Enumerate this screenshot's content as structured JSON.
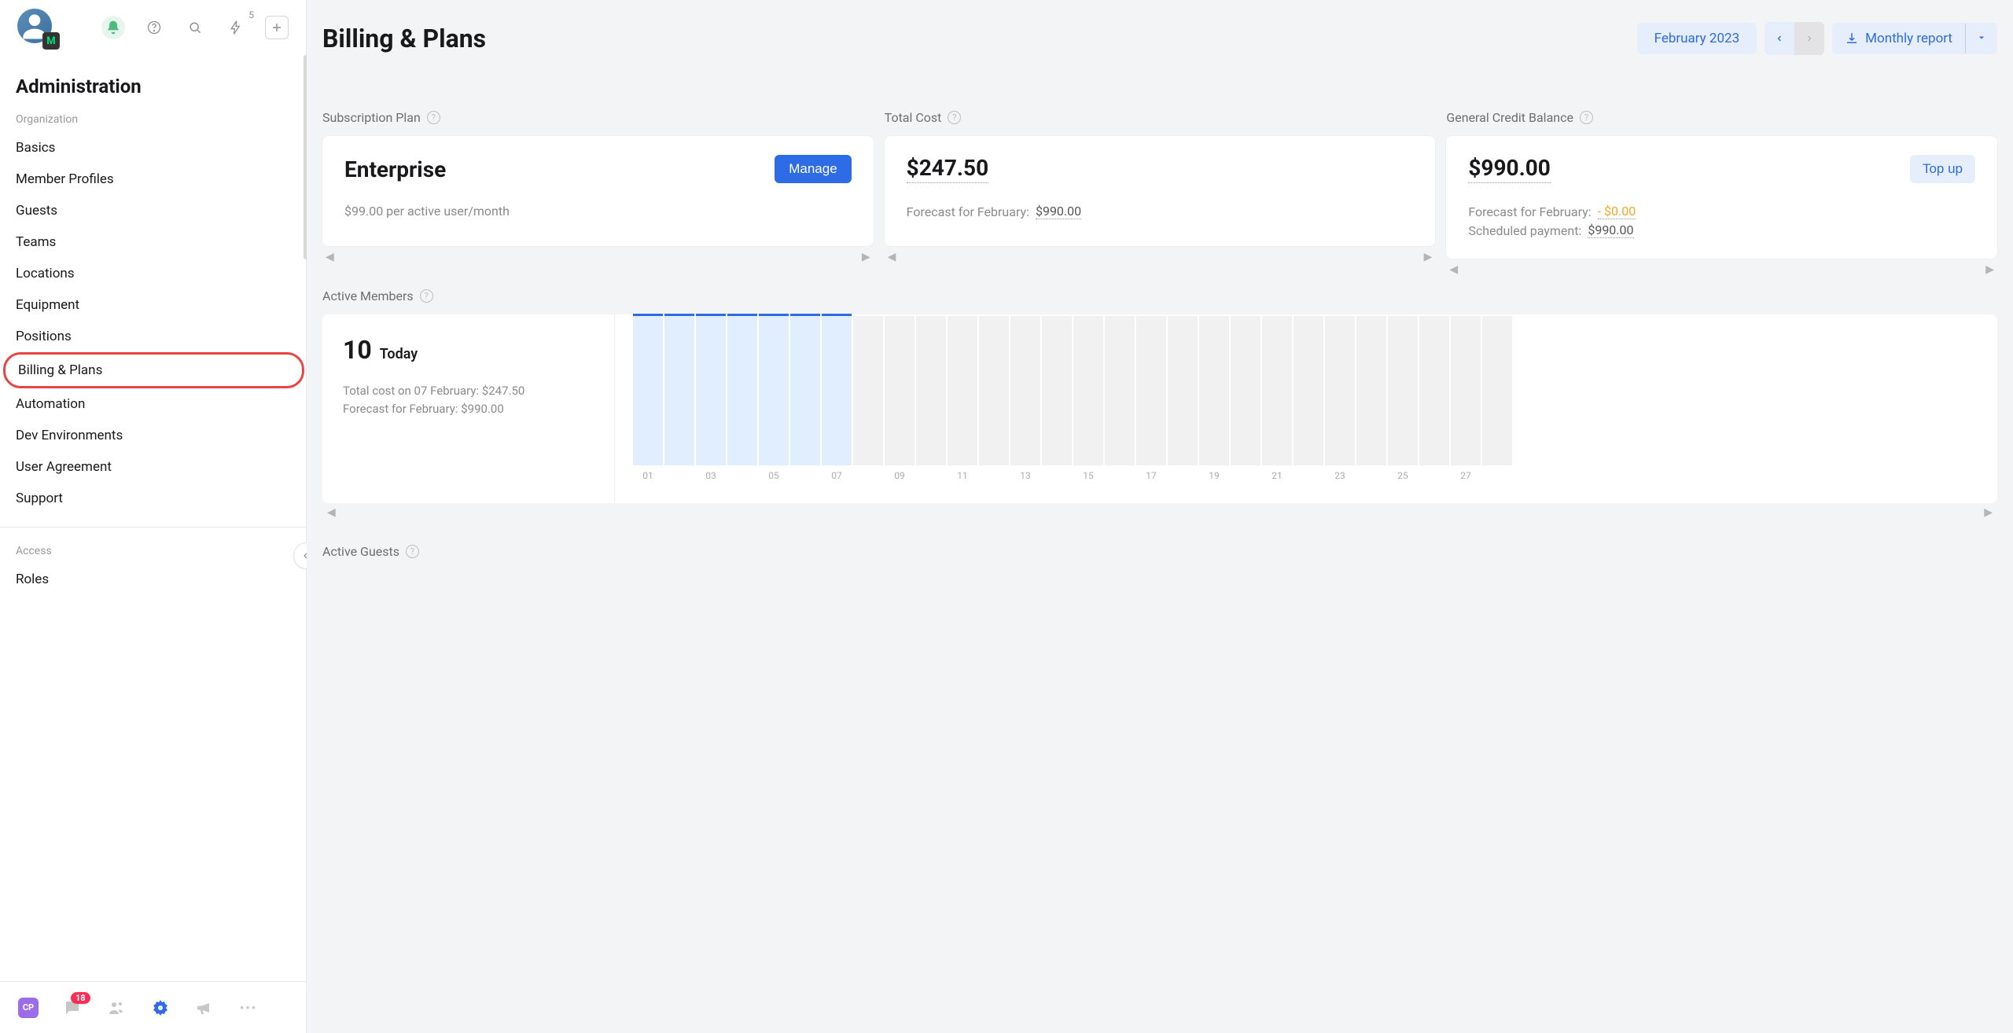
{
  "topbar": {
    "bolt_badge": "5"
  },
  "sidebar": {
    "section_title": "Administration",
    "group_org": "Organization",
    "group_access": "Access",
    "items_org": [
      "Basics",
      "Member Profiles",
      "Guests",
      "Teams",
      "Locations",
      "Equipment",
      "Positions",
      "Billing & Plans",
      "Automation",
      "Dev Environments",
      "User Agreement",
      "Support"
    ],
    "items_access": [
      "Roles"
    ],
    "active_item": "Billing & Plans"
  },
  "bottom": {
    "cp": "CP",
    "chat_badge": "18"
  },
  "header": {
    "title": "Billing & Plans",
    "period": "February 2023",
    "report_label": "Monthly report"
  },
  "cards": {
    "plan": {
      "section": "Subscription Plan",
      "name": "Enterprise",
      "manage": "Manage",
      "sub": "$99.00 per active user/month"
    },
    "cost": {
      "section": "Total Cost",
      "amount": "$247.50",
      "forecast_label": "Forecast for February:",
      "forecast_value": "$990.00"
    },
    "credit": {
      "section": "General Credit Balance",
      "amount": "$990.00",
      "topup": "Top up",
      "forecast_label": "Forecast for February:",
      "forecast_value": "- $0.00",
      "scheduled_label": "Scheduled payment:",
      "scheduled_value": "$990.00"
    }
  },
  "members": {
    "section": "Active Members",
    "count": "10",
    "today": "Today",
    "line1": "Total cost on 07 February: $247.50",
    "line2": "Forecast for February: $990.00"
  },
  "chart_data": {
    "type": "bar",
    "x_labels": [
      "01",
      "03",
      "05",
      "07",
      "09",
      "11",
      "13",
      "15",
      "17",
      "19",
      "21",
      "23",
      "25",
      "27"
    ],
    "active_through_index": 6,
    "bar_count": 28,
    "values": [
      10,
      10,
      10,
      10,
      10,
      10,
      10,
      0,
      0,
      0,
      0,
      0,
      0,
      0,
      0,
      0,
      0,
      0,
      0,
      0,
      0,
      0,
      0,
      0,
      0,
      0,
      0,
      0
    ],
    "ylim": [
      0,
      10
    ]
  },
  "guests": {
    "section": "Active Guests"
  }
}
